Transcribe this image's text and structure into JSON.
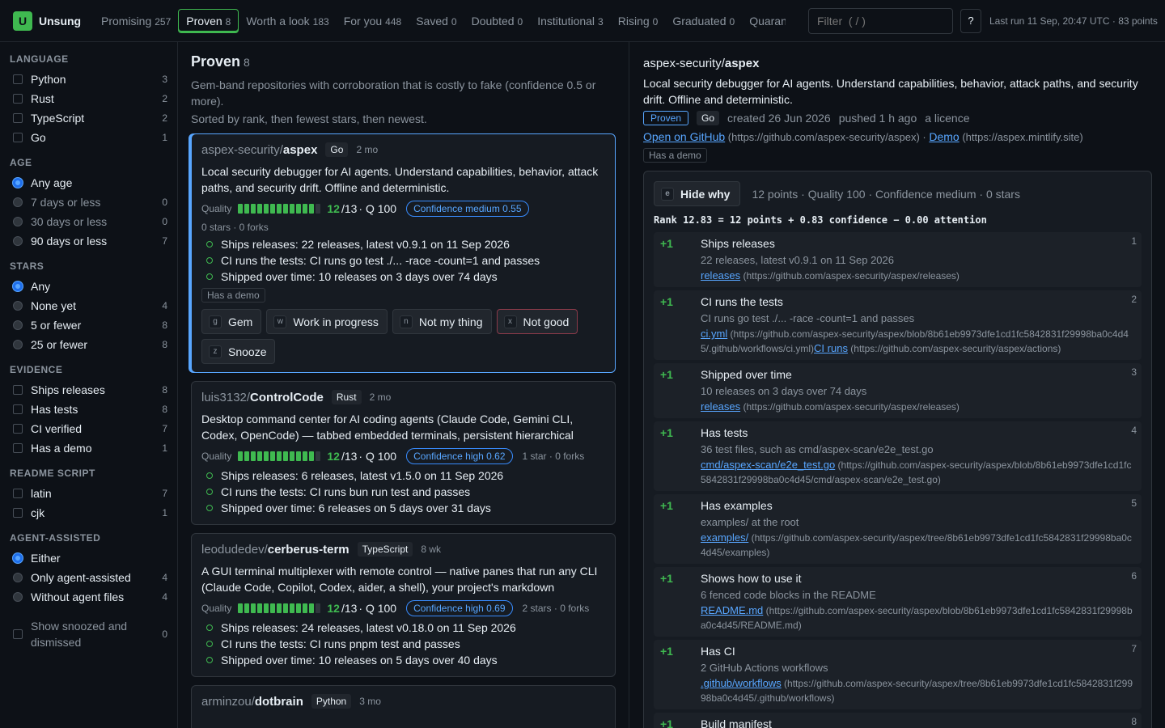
{
  "brand": {
    "logo": "U",
    "name": "Unsung"
  },
  "tabs": [
    {
      "label": "Promising",
      "count": "257"
    },
    {
      "label": "Proven",
      "count": "8"
    },
    {
      "label": "Worth a look",
      "count": "183"
    },
    {
      "label": "For you",
      "count": "448"
    },
    {
      "label": "Saved",
      "count": "0"
    },
    {
      "label": "Doubted",
      "count": "0"
    },
    {
      "label": "Institutional",
      "count": "3"
    },
    {
      "label": "Rising",
      "count": "0"
    },
    {
      "label": "Graduated",
      "count": "0"
    },
    {
      "label": "Quarantined",
      "count": ""
    }
  ],
  "active_tab": "Proven",
  "filter": {
    "placeholder": "Filter  ( / )"
  },
  "help_label": "?",
  "last_run": "Last run 11 Sep, 20:47 UTC · 83 points",
  "sidebar": {
    "language": {
      "title": "LANGUAGE",
      "options": [
        {
          "label": "Python",
          "count": "3"
        },
        {
          "label": "Rust",
          "count": "2"
        },
        {
          "label": "TypeScript",
          "count": "2"
        },
        {
          "label": "Go",
          "count": "1"
        }
      ]
    },
    "age": {
      "title": "AGE",
      "options": [
        {
          "label": "Any age",
          "count": "",
          "selected": true
        },
        {
          "label": "7 days or less",
          "count": "0"
        },
        {
          "label": "30 days or less",
          "count": "0"
        },
        {
          "label": "90 days or less",
          "count": "7"
        }
      ]
    },
    "stars": {
      "title": "STARS",
      "options": [
        {
          "label": "Any",
          "count": "",
          "selected": true
        },
        {
          "label": "None yet",
          "count": "4"
        },
        {
          "label": "5 or fewer",
          "count": "8"
        },
        {
          "label": "25 or fewer",
          "count": "8"
        }
      ]
    },
    "evidence": {
      "title": "EVIDENCE",
      "options": [
        {
          "label": "Ships releases",
          "count": "8"
        },
        {
          "label": "Has tests",
          "count": "8"
        },
        {
          "label": "CI verified",
          "count": "7"
        },
        {
          "label": "Has a demo",
          "count": "1"
        }
      ]
    },
    "readme": {
      "title": "README SCRIPT",
      "options": [
        {
          "label": "latin",
          "count": "7"
        },
        {
          "label": "cjk",
          "count": "1"
        }
      ]
    },
    "agent": {
      "title": "AGENT-ASSISTED",
      "options": [
        {
          "label": "Either",
          "count": "",
          "selected": true
        },
        {
          "label": "Only agent-assisted",
          "count": "4"
        },
        {
          "label": "Without agent files",
          "count": "4"
        }
      ]
    },
    "snoozed": {
      "label": "Show snoozed and dismissed",
      "count": "0"
    }
  },
  "list": {
    "title": "Proven",
    "count": "8",
    "description": "Gem-band repositories with corroboration that is costly to fake (confidence 0.5 or more).",
    "sort": "Sorted by rank, then fewest stars, then newest.",
    "cards": [
      {
        "owner": "aspex-security/",
        "repo": "aspex",
        "lang": "Go",
        "age": "2 mo",
        "desc": "Local security debugger for AI agents. Understand capabilities, behavior, attack paths, and security drift. Offline and deterministic.",
        "quality_label": "Quality",
        "score": "12",
        "score_max": "/13",
        "q": "· Q 100",
        "confidence": "Confidence medium 0.55",
        "stars": "0 stars · 0 forks",
        "bullets": [
          "Ships releases: 22 releases, latest v0.9.1 on 11 Sep 2026",
          "CI runs the tests: CI runs go test ./... -race -count=1 and passes",
          "Shipped over time: 10 releases on 3 days over 74 days"
        ],
        "chip": "Has a demo"
      },
      {
        "owner": "luis3132/",
        "repo": "ControlCode",
        "lang": "Rust",
        "age": "2 mo",
        "desc": "Desktop command center for AI coding agents (Claude Code, Gemini CLI, Codex, OpenCode) — tabbed embedded terminals, persistent hierarchical workspaces,...",
        "quality_label": "Quality",
        "score": "12",
        "score_max": "/13",
        "q": "· Q 100",
        "confidence": "Confidence high 0.62",
        "stars": "1 star · 0 forks",
        "bullets": [
          "Ships releases: 6 releases, latest v1.5.0 on 11 Sep 2026",
          "CI runs the tests: CI runs bun run test and passes",
          "Shipped over time: 6 releases on 5 days over 31 days"
        ]
      },
      {
        "owner": "leodudedev/",
        "repo": "cerberus-term",
        "lang": "TypeScript",
        "age": "8 wk",
        "desc": "A GUI terminal multiplexer with remote control — native panes that run any CLI (Claude Code, Copilot, Codex, aider, a shell), your project's markdown rendered...",
        "quality_label": "Quality",
        "score": "12",
        "score_max": "/13",
        "q": "· Q 100",
        "confidence": "Confidence high 0.69",
        "stars": "2 stars · 0 forks",
        "bullets": [
          "Ships releases: 24 releases, latest v0.18.0 on 11 Sep 2026",
          "CI runs the tests: CI runs pnpm test and passes",
          "Shipped over time: 10 releases on 5 days over 40 days"
        ]
      },
      {
        "owner": "arminzou/",
        "repo": "dotbrain",
        "lang": "Python",
        "age": "3 mo"
      }
    ],
    "quality_value": 12,
    "quality_max": 13,
    "actions": [
      {
        "key": "g",
        "label": "Gem"
      },
      {
        "key": "w",
        "label": "Work in progress"
      },
      {
        "key": "n",
        "label": "Not my thing"
      },
      {
        "key": "x",
        "label": "Not good"
      },
      {
        "key": "z",
        "label": "Snooze"
      }
    ]
  },
  "detail": {
    "owner": "aspex-security/",
    "repo": "aspex",
    "desc": "Local security debugger for AI agents. Understand capabilities, behavior, attack paths, and security drift. Offline and deterministic.",
    "band": "Proven",
    "lang": "Go",
    "created": "created 26 Jun 2026",
    "pushed": "pushed 1 h ago",
    "licence": "a licence",
    "github_link": "Open on GitHub",
    "github_url": "(https://github.com/aspex-security/aspex)",
    "sep": " · ",
    "demo_link": "Demo",
    "demo_url": "(https://aspex.mintlify.site)",
    "chip": "Has a demo",
    "why": {
      "hide_key": "e",
      "hide_label": "Hide why",
      "summary": "12 points · Quality 100 · Confidence medium · 0 stars",
      "rank": "Rank 12.83 = 12 points + 0.83 confidence − 0.00 attention",
      "reasons": [
        {
          "pts": "+1",
          "title": "Ships releases",
          "detail": "22 releases, latest v0.9.1 on 11 Sep 2026",
          "link": "releases",
          "url": " (https://github.com/aspex-security/aspex/releases)",
          "num": "1"
        },
        {
          "pts": "+1",
          "title": "CI runs the tests",
          "detail": "CI runs go test ./... -race -count=1 and passes",
          "link": "ci.yml",
          "url": " (https://github.com/aspex-security/aspex/blob/8b61eb9973dfe1cd1fc5842831f29998ba0c4d45/.github/workflows/ci.yml)",
          "link2": "CI runs",
          "url2": " (https://github.com/aspex-security/aspex/actions)",
          "num": "2"
        },
        {
          "pts": "+1",
          "title": "Shipped over time",
          "detail": "10 releases on 3 days over 74 days",
          "link": "releases",
          "url": " (https://github.com/aspex-security/aspex/releases)",
          "num": "3"
        },
        {
          "pts": "+1",
          "title": "Has tests",
          "detail": "36 test files, such as cmd/aspex-scan/e2e_test.go",
          "link": "cmd/aspex-scan/e2e_test.go",
          "url": " (https://github.com/aspex-security/aspex/blob/8b61eb9973dfe1cd1fc5842831f29998ba0c4d45/cmd/aspex-scan/e2e_test.go)",
          "num": "4"
        },
        {
          "pts": "+1",
          "title": "Has examples",
          "detail": "examples/ at the root",
          "link": "examples/",
          "url": " (https://github.com/aspex-security/aspex/tree/8b61eb9973dfe1cd1fc5842831f29998ba0c4d45/examples)",
          "num": "5"
        },
        {
          "pts": "+1",
          "title": "Shows how to use it",
          "detail": "6 fenced code blocks in the README",
          "link": "README.md",
          "url": " (https://github.com/aspex-security/aspex/blob/8b61eb9973dfe1cd1fc5842831f29998ba0c4d45/README.md)",
          "num": "6"
        },
        {
          "pts": "+1",
          "title": "Has CI",
          "detail": "2 GitHub Actions workflows",
          "link": ".github/workflows",
          "url": " (https://github.com/aspex-security/aspex/tree/8b61eb9973dfe1cd1fc5842831f29998ba0c4d45/.github/workflows)",
          "num": "7"
        },
        {
          "pts": "+1",
          "title": "Build manifest",
          "detail": "",
          "link": "",
          "url": "",
          "num": "8"
        }
      ]
    }
  },
  "colors": {
    "accent": "#3fb950",
    "link": "#58a6ff",
    "bg": "#0d1117",
    "panel": "#161b22",
    "danger": "#8b3a4a"
  }
}
